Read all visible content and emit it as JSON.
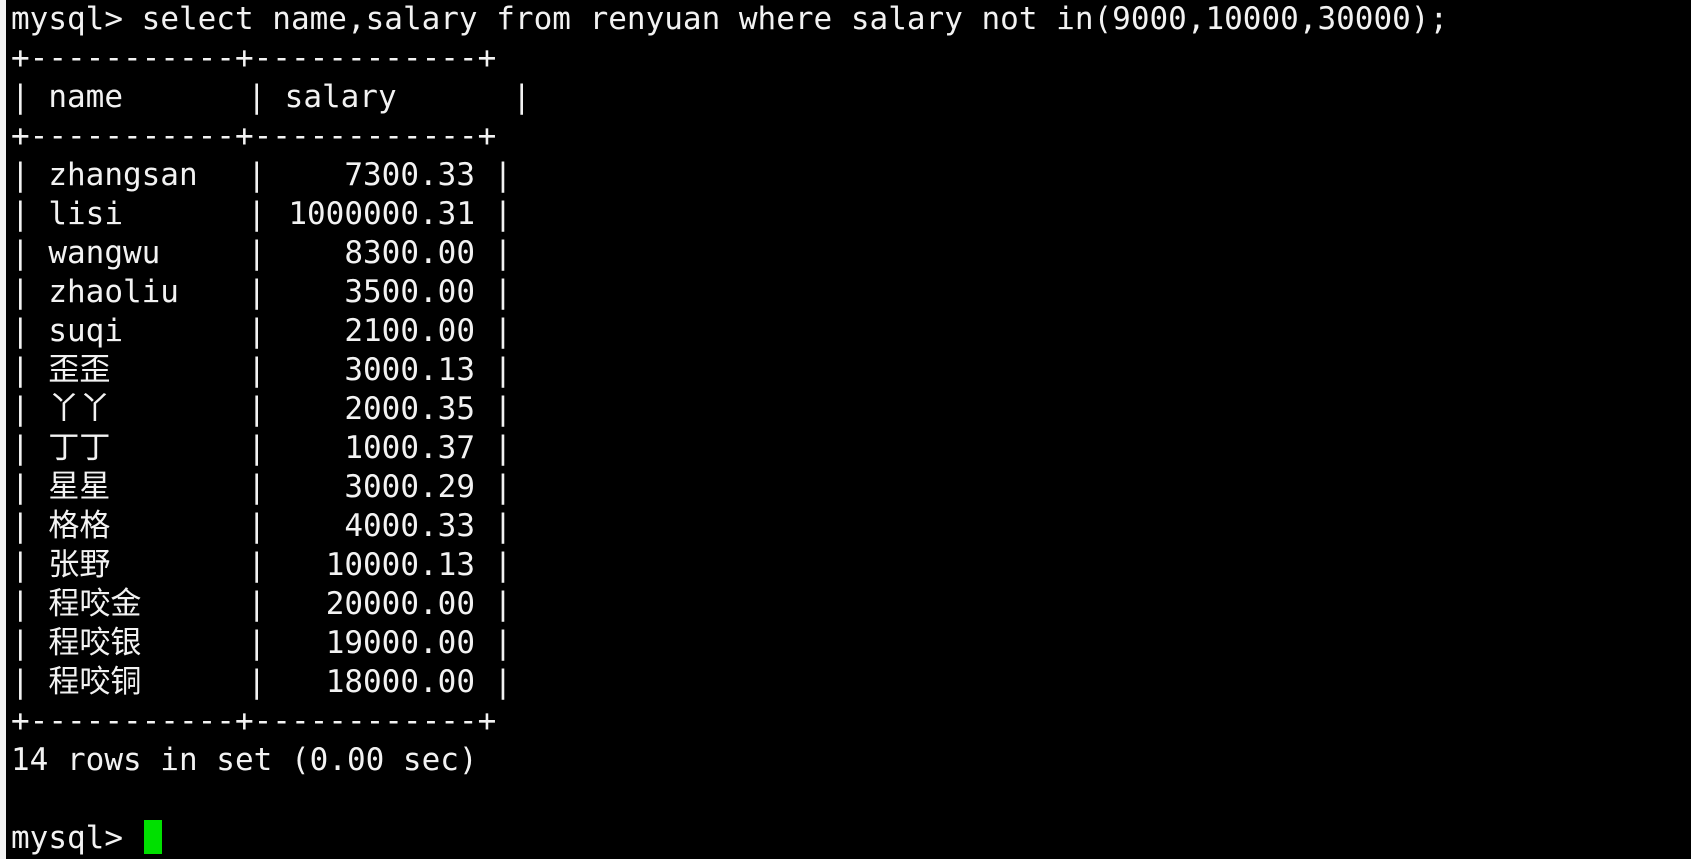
{
  "terminal": {
    "prompt": "mysql> ",
    "command": "select name,salary from renyuan where salary not in(9000,10000,30000);",
    "border": "+-----------+------------+",
    "headers": {
      "name": "name",
      "salary": "salary"
    },
    "rows": [
      {
        "name": "zhangsan",
        "salary": "7300.33"
      },
      {
        "name": "lisi",
        "salary": "1000000.31"
      },
      {
        "name": "wangwu",
        "salary": "8300.00"
      },
      {
        "name": "zhaoliu",
        "salary": "3500.00"
      },
      {
        "name": "suqi",
        "salary": "2100.00"
      },
      {
        "name": "歪歪",
        "salary": "3000.13"
      },
      {
        "name": "丫丫",
        "salary": "2000.35"
      },
      {
        "name": "丁丁",
        "salary": "1000.37"
      },
      {
        "name": "星星",
        "salary": "3000.29"
      },
      {
        "name": "格格",
        "salary": "4000.33"
      },
      {
        "name": "张野",
        "salary": "10000.13"
      },
      {
        "name": "程咬金",
        "salary": "20000.00"
      },
      {
        "name": "程咬银",
        "salary": "19000.00"
      },
      {
        "name": "程咬铜",
        "salary": "18000.00"
      }
    ],
    "summary": "14 rows in set (0.00 sec)",
    "prompt2": "mysql> "
  },
  "colors": {
    "background": "#000000",
    "foreground": "#f2f2f2",
    "cursor": "#00e000"
  }
}
